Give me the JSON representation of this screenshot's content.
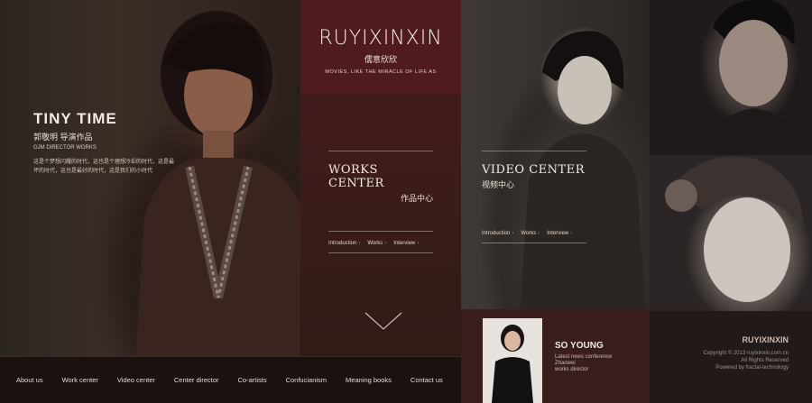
{
  "brand": {
    "logo": "RUYIXINXIN",
    "cn_name": "儒意欣欣",
    "tagline": "MOVIES, LIKE THE MIRACLE OF LIFE AS"
  },
  "hero": {
    "title": "TINY TIME",
    "subtitle_cn": "郭敬明 导演作品",
    "subtitle_en": "GJM DIRECTOR WORKS",
    "description": "这是个梦想闪耀的时代，这也是个理想冷却的时代，这是最坏的时代，这也是最好的时代，这是我们的小时代"
  },
  "works_center": {
    "title_en": "WORKS CENTER",
    "title_cn": "作品中心",
    "links": [
      "Introduction",
      "Works",
      "Interview"
    ]
  },
  "video_center": {
    "title_en": "VIDEO CENTER",
    "title_cn": "视频中心",
    "links": [
      "Introduction",
      "Works",
      "Interview"
    ]
  },
  "so_young": {
    "title": "SO YOUNG",
    "meta": [
      "Latest news conference",
      "Zhaowei",
      "works director"
    ]
  },
  "footer_brand": {
    "name": "RUYIXINXIN",
    "copy": [
      "Copyright © 2013 ruyixinxin.com.cn",
      "All Rights Reserved",
      "Powered by fractal-technology"
    ]
  },
  "nav": {
    "items": [
      "About us",
      "Work center",
      "Video center",
      "Center director",
      "Co-artists",
      "Confucianism",
      "Meaning books",
      "Contact us"
    ]
  },
  "icons": {
    "chevron": "chevron-right-icon",
    "down": "chevron-down-icon"
  },
  "colors": {
    "maroon": "#4f1b1f",
    "so_young_bg": "#3a1e1e"
  }
}
